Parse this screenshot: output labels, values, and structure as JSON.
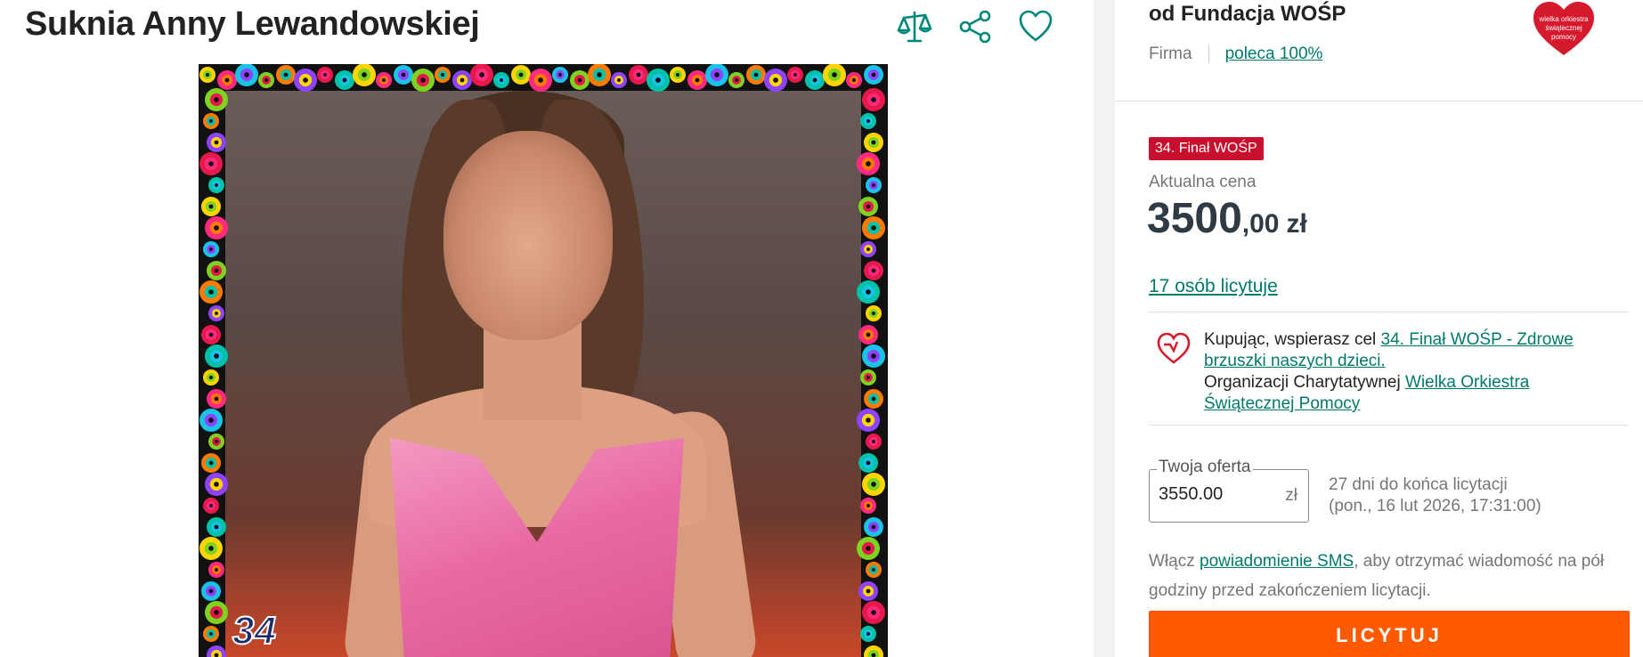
{
  "product": {
    "title": "Suknia Anny Lewandowskiej",
    "image_badge": "34"
  },
  "icons": {
    "compare": "scale-icon",
    "share": "share-icon",
    "favorite": "heart-icon"
  },
  "seller": {
    "name": "od Fundacja WOŚP",
    "type": "Firma",
    "recommend": "poleca 100%",
    "logo_text": "wielka orkiestra świątecznej pomocy"
  },
  "auction": {
    "tag": "34. Finał WOŚP",
    "price_label": "Aktualna cena",
    "price_int": "3500",
    "price_dec": ",00",
    "currency": "zł",
    "bidders": "17 osób licytuje"
  },
  "charity": {
    "prefix": "Kupując, wspierasz cel ",
    "goal_link": "34. Finał WOŚP - Zdrowe brzuszki naszych dzieci.",
    "org_prefix": "Organizacji Charytatywnej ",
    "org_link": "Wielka Orkiestra Świątecznej Pomocy"
  },
  "offer": {
    "legend": "Twoja oferta",
    "value": "3550.00",
    "unit": "zł",
    "deadline_line1": "27 dni do końca licytacji",
    "deadline_line2": "(pon., 16 lut 2026, 17:31:00)"
  },
  "sms": {
    "prefix": "Włącz ",
    "link": "powiadomienie SMS",
    "suffix": ", aby otrzymać wiadomość na pół godziny przed zakończeniem licytacji."
  },
  "button": {
    "bid": "LICYTUJ"
  },
  "colors": {
    "accent": "#00796b",
    "button": "#ff5a00",
    "tag": "#c8102e",
    "price": "#2f3a45"
  }
}
